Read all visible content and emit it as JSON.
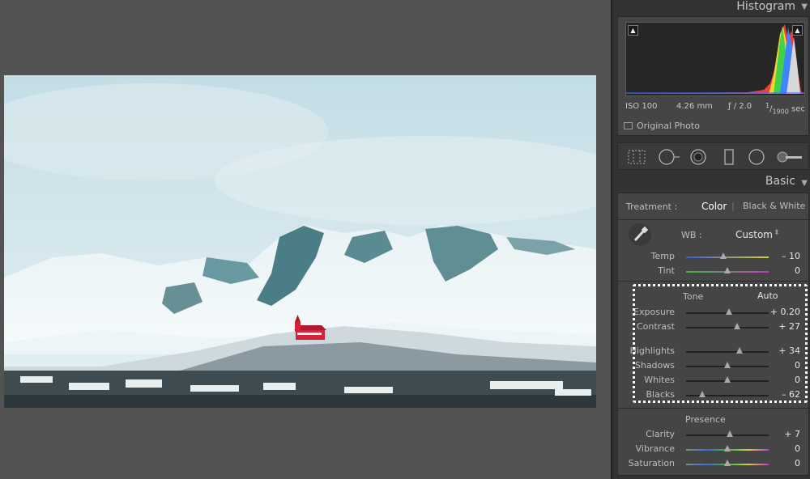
{
  "histogram": {
    "title": "Histogram",
    "iso": "ISO 100",
    "focal": "4.26 mm",
    "aperture": "ƒ / 2.0",
    "shutter_num": "1",
    "shutter_den": "1900",
    "shutter_unit": "sec",
    "original_photo": "Original Photo"
  },
  "basic": {
    "title": "Basic",
    "treatment_label": "Treatment :",
    "treatment_color": "Color",
    "treatment_bw": "Black & White",
    "wb_label": "WB :",
    "wb_value": "Custom",
    "tone_label": "Tone",
    "auto_label": "Auto",
    "presence_label": "Presence",
    "sliders": {
      "temp": {
        "label": "Temp",
        "value": "– 10",
        "level": 0.45
      },
      "tint": {
        "label": "Tint",
        "value": "0",
        "level": 0.5
      },
      "exposure": {
        "label": "Exposure",
        "value": "+ 0.20",
        "level": 0.52
      },
      "contrast": {
        "label": "Contrast",
        "value": "+ 27",
        "level": 0.62
      },
      "highlights": {
        "label": "Highlights",
        "value": "+ 34",
        "level": 0.65
      },
      "shadows": {
        "label": "Shadows",
        "value": "0",
        "level": 0.5
      },
      "whites": {
        "label": "Whites",
        "value": "0",
        "level": 0.5
      },
      "blacks": {
        "label": "Blacks",
        "value": "– 62",
        "level": 0.2
      },
      "clarity": {
        "label": "Clarity",
        "value": "+ 7",
        "level": 0.53
      },
      "vibrance": {
        "label": "Vibrance",
        "value": "0",
        "level": 0.5
      },
      "saturation": {
        "label": "Saturation",
        "value": "0",
        "level": 0.5
      }
    }
  },
  "colors": {
    "panel_bg": "#454545",
    "app_bg": "#535353",
    "highlight_dots": "#ffffff"
  }
}
